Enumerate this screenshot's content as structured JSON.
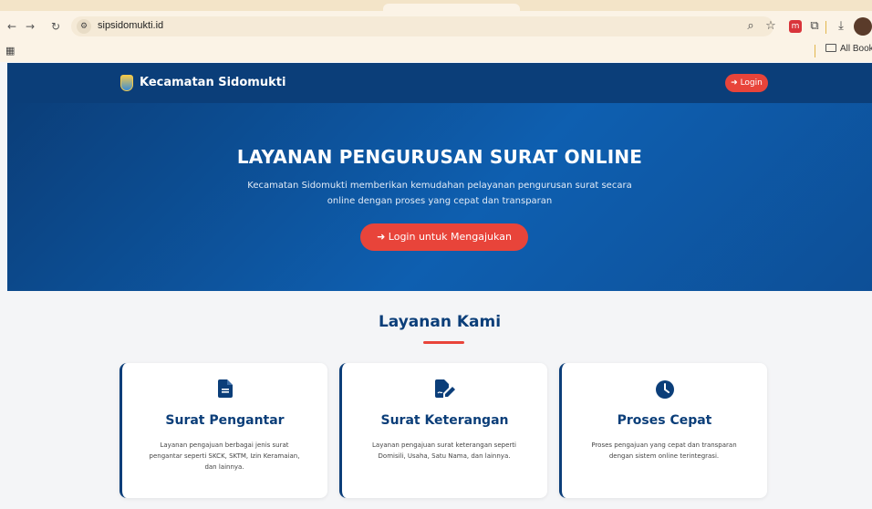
{
  "browser": {
    "url": "sipsidomukti.id",
    "bookmarks_label": "All Bookm"
  },
  "site": {
    "brand_name": "Kecamatan Sidomukti",
    "nav_login_label": "Login"
  },
  "hero": {
    "title": "LAYANAN PENGURUSAN SURAT ONLINE",
    "subtitle": "Kecamatan Sidomukti memberikan kemudahan pelayanan pengurusan surat secara online dengan proses yang cepat dan transparan",
    "cta_label": "Login untuk Mengajukan"
  },
  "services": {
    "title": "Layanan Kami",
    "cards": [
      {
        "icon": "document-icon",
        "title": "Surat Pengantar",
        "description": "Layanan pengajuan berbagai jenis surat pengantar seperti SKCK, SKTM, Izin Keramaian, dan lainnya."
      },
      {
        "icon": "signature-icon",
        "title": "Surat Keterangan",
        "description": "Layanan pengajuan surat keterangan seperti Domisili, Usaha, Satu Nama, dan lainnya."
      },
      {
        "icon": "clock-icon",
        "title": "Proses Cepat",
        "description": "Proses pengajuan yang cepat dan transparan dengan sistem online terintegrasi."
      }
    ]
  },
  "colors": {
    "primary": "#0b3e79",
    "accent": "#e8443a"
  }
}
